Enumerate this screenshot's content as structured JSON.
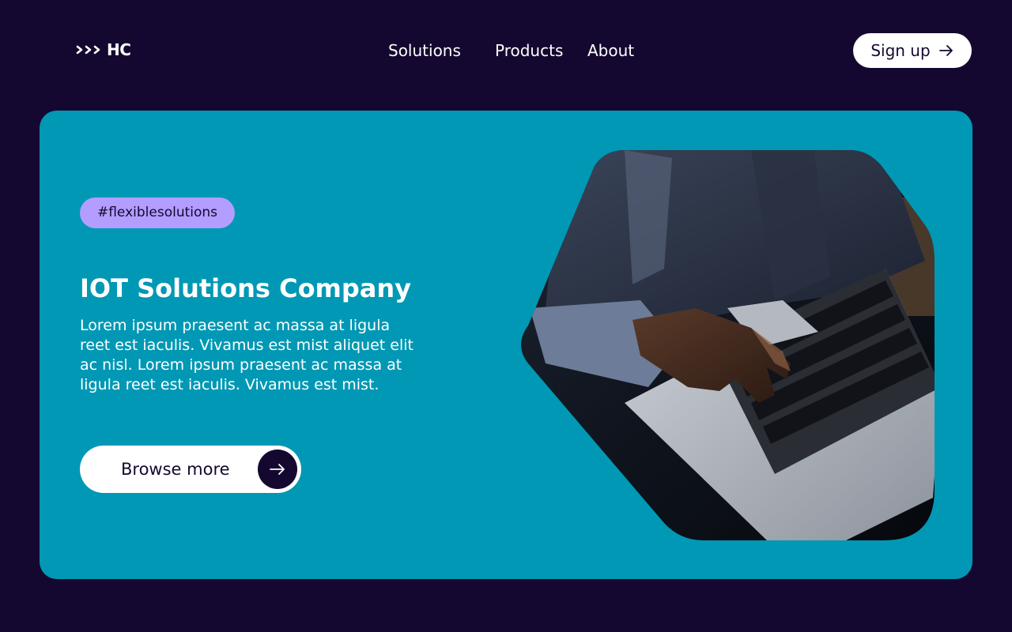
{
  "header": {
    "logo_text": "HC",
    "nav": {
      "solutions": "Solutions",
      "products": "Products",
      "about": "About"
    },
    "signup_label": "Sign up"
  },
  "hero": {
    "tag": "#flexiblesolutions",
    "title": "IOT Solutions Company",
    "body": "Lorem ipsum praesent ac massa at ligula reet est iaculis. Vivamus est mist aliquet elit ac nisl. Lorem ipsum praesent ac massa at ligula reet est iaculis. Vivamus est mist.",
    "cta_label": "Browse more"
  },
  "colors": {
    "background": "#150830",
    "hero": "#0098b4",
    "tag": "#b39dff",
    "white": "#ffffff"
  },
  "icons": {
    "logo": "triple-chevron-icon",
    "signup": "arrow-right-icon",
    "cta": "arrow-right-icon"
  }
}
